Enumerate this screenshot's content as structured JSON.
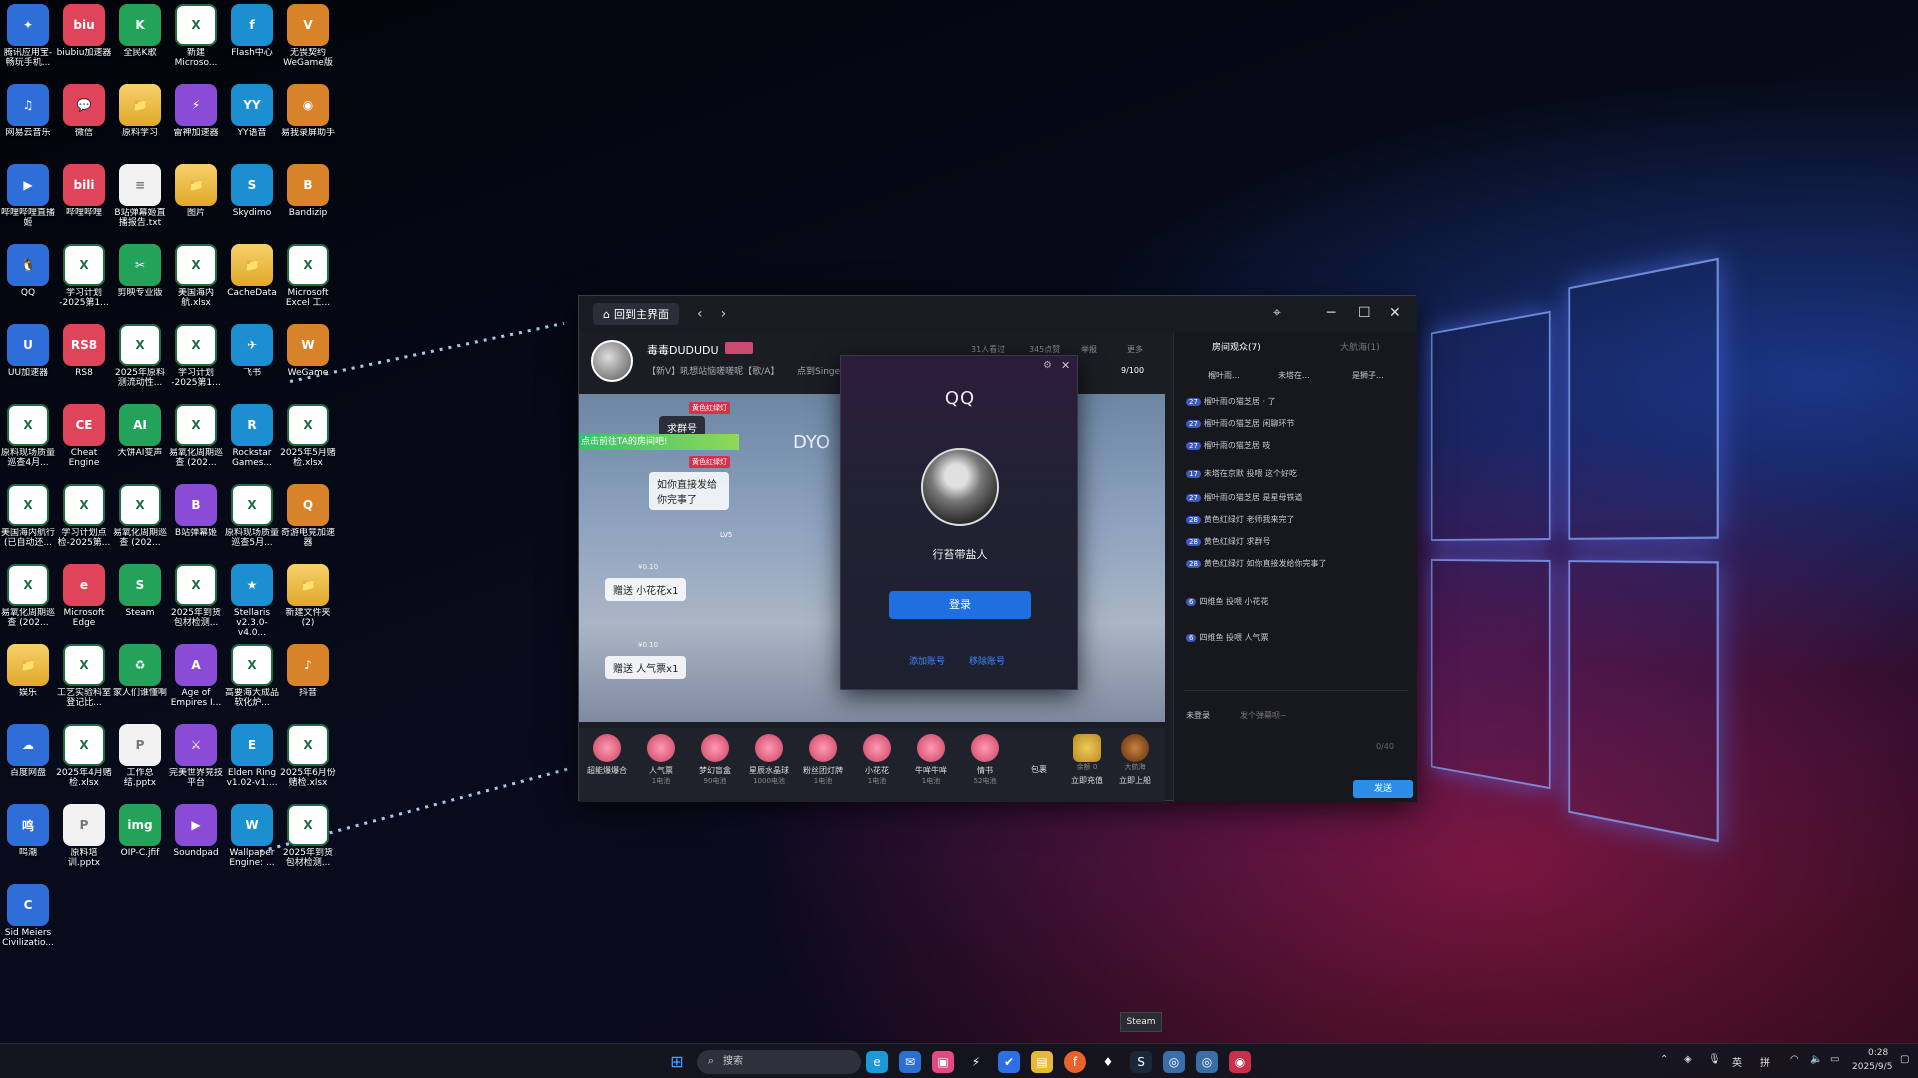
{
  "desktop": {
    "icons": [
      {
        "label": "腾讯应用宝-畅玩手机...",
        "glyph": "✦"
      },
      {
        "label": "biubiu加速器",
        "glyph": "biu"
      },
      {
        "label": "全民K歌",
        "glyph": "K"
      },
      {
        "label": "新建 Microso...",
        "glyph": "X"
      },
      {
        "label": "Flash中心",
        "glyph": "f"
      },
      {
        "label": "无畏契约 WeGame版",
        "glyph": "V"
      },
      {
        "label": "网易云音乐",
        "glyph": "♫"
      },
      {
        "label": "微信",
        "glyph": "💬"
      },
      {
        "label": "原料学习",
        "glyph": "📁"
      },
      {
        "label": "雷神加速器",
        "glyph": "⚡"
      },
      {
        "label": "YY语音",
        "glyph": "YY"
      },
      {
        "label": "易我录屏助手",
        "glyph": "◉"
      },
      {
        "label": "哔哩哔哩直播姬",
        "glyph": "▶"
      },
      {
        "label": "哔哩哔哩",
        "glyph": "bili"
      },
      {
        "label": "B站弹幕姬直播报告.txt",
        "glyph": "≡"
      },
      {
        "label": "图片",
        "glyph": "📁"
      },
      {
        "label": "Skydimo",
        "glyph": "S"
      },
      {
        "label": "Bandizip",
        "glyph": "B"
      },
      {
        "label": "QQ",
        "glyph": "🐧"
      },
      {
        "label": "学习计划 -2025第1...",
        "glyph": "X"
      },
      {
        "label": "剪映专业版",
        "glyph": "✂"
      },
      {
        "label": "美国海内航.xlsx",
        "glyph": "X"
      },
      {
        "label": "CacheData",
        "glyph": "📁"
      },
      {
        "label": "Microsoft Excel 工...",
        "glyph": "X"
      },
      {
        "label": "UU加速器",
        "glyph": "U"
      },
      {
        "label": "RS8",
        "glyph": "RS8"
      },
      {
        "label": "2025年原料测流动性...",
        "glyph": "X"
      },
      {
        "label": "学习计划 -2025第1...",
        "glyph": "X"
      },
      {
        "label": "飞书",
        "glyph": "✈"
      },
      {
        "label": "WeGame",
        "glyph": "W"
      },
      {
        "label": "原料现场质量巡查4月...",
        "glyph": "X"
      },
      {
        "label": "Cheat Engine",
        "glyph": "CE"
      },
      {
        "label": "大饼AI变声",
        "glyph": "AI"
      },
      {
        "label": "易氧化周期巡查 (202...",
        "glyph": "X"
      },
      {
        "label": "Rockstar Games...",
        "glyph": "R"
      },
      {
        "label": "2025年5月赌检.xlsx",
        "glyph": "X"
      },
      {
        "label": "美国海内航行(已自动还...",
        "glyph": "X"
      },
      {
        "label": "学习计划点检-2025第...",
        "glyph": "X"
      },
      {
        "label": "易氧化周期巡查 (202...",
        "glyph": "X"
      },
      {
        "label": "B站弹幕姬",
        "glyph": "B"
      },
      {
        "label": "原料现场质量巡查5月...",
        "glyph": "X"
      },
      {
        "label": "奇游电竞加速器",
        "glyph": "Q"
      },
      {
        "label": "易氧化周期巡查 (202...",
        "glyph": "X"
      },
      {
        "label": "Microsoft Edge",
        "glyph": "e"
      },
      {
        "label": "Steam",
        "glyph": "S"
      },
      {
        "label": "2025年到货包材检测...",
        "glyph": "X"
      },
      {
        "label": "Stellaris v2.3.0-v4.0...",
        "glyph": "★"
      },
      {
        "label": "新建文件夹 (2)",
        "glyph": "📁"
      },
      {
        "label": "娱乐",
        "glyph": "📁"
      },
      {
        "label": "工艺实验科室登记比...",
        "glyph": "X"
      },
      {
        "label": "家人们谁懂啊",
        "glyph": "♻"
      },
      {
        "label": "Age of Empires I...",
        "glyph": "A"
      },
      {
        "label": "高要海大成品软化炉...",
        "glyph": "X"
      },
      {
        "label": "抖音",
        "glyph": "♪"
      },
      {
        "label": "百度网盘",
        "glyph": "☁"
      },
      {
        "label": "2025年4月赌检.xlsx",
        "glyph": "X"
      },
      {
        "label": "工作总结.pptx",
        "glyph": "P"
      },
      {
        "label": "完美世界竞技平台",
        "glyph": "⚔"
      },
      {
        "label": "Elden Ring v1.02-v1....",
        "glyph": "E"
      },
      {
        "label": "2025年6月份赌检.xlsx",
        "glyph": "X"
      },
      {
        "label": "鸣潮",
        "glyph": "鸣"
      },
      {
        "label": "原料培训.pptx",
        "glyph": "P"
      },
      {
        "label": "OIP-C.jfif",
        "glyph": "img"
      },
      {
        "label": "Soundpad",
        "glyph": "▶"
      },
      {
        "label": "Wallpaper Engine: ...",
        "glyph": "W"
      },
      {
        "label": "2025年到货包材检测...",
        "glyph": "X"
      },
      {
        "label": "Sid Meiers Civilizatio...",
        "glyph": "C"
      }
    ]
  },
  "live_app": {
    "home_button": "回到主界面",
    "nav_back": "‹",
    "nav_forward": "›",
    "streamer_name": "毒毒DUDUDU",
    "streamer_tag": "【新V】吼想站恼嗟嗟呢【歌/A】",
    "streamer_sub2": "点到Singer",
    "stats": [
      "31人看过",
      "345点赞",
      "举报",
      "更多"
    ],
    "gift_progress": "9/100",
    "video_overlay": {
      "top_tag": "黄色红绿灯",
      "name1": "求群号",
      "banner": "点击前往TA的房间吧!",
      "tag2": "黄色红绿灯",
      "bubble": "如你直接发给你完事了",
      "lv": "LV5",
      "gift1_price": "¥0.10",
      "gift1_text": "赠送 小花花x1",
      "gift2_price": "¥0.10",
      "gift2_text": "赠送 人气票x1",
      "scroll_text": "DYO"
    },
    "gifts": [
      {
        "name": "超能爆爆合",
        "price": ""
      },
      {
        "name": "人气票",
        "price": "1电池"
      },
      {
        "name": "梦幻盲盒",
        "price": "90电池"
      },
      {
        "name": "星辰水晶球",
        "price": "1000电池"
      },
      {
        "name": "粉丝团灯牌",
        "price": "1电池"
      },
      {
        "name": "小花花",
        "price": "1电池"
      },
      {
        "name": "牛哞牛哞",
        "price": "1电池"
      },
      {
        "name": "情书",
        "price": "52电池"
      }
    ],
    "pack_label": "包裹",
    "balance_label": "余额 0",
    "recharge": "立即充值",
    "captain_label": "大航海",
    "captain_action": "立即上船",
    "side_tabs": [
      "房间观众(7)",
      "大航海(1)"
    ],
    "audience": [
      "榴叶雨...",
      "未塔在...",
      "是狮子..."
    ],
    "messages": [
      {
        "lv": "27",
        "text": "榴叶雨の猫芝居 · 了"
      },
      {
        "lv": "27",
        "text": "榴叶雨の猫芝居 闲聊环节"
      },
      {
        "lv": "27",
        "text": "榴叶雨の猫芝居 吱"
      },
      {
        "lv": "17",
        "text": "未塔在京默 投喂 这个好吃"
      },
      {
        "lv": "27",
        "text": "榴叶雨の猫芝居 是星母铁道"
      },
      {
        "lv": "28",
        "text": "黄色红绿灯 老师我来完了"
      },
      {
        "lv": "28",
        "text": "黄色红绿灯 求群号"
      },
      {
        "lv": "28",
        "text": "黄色红绿灯 如你直接发给你完事了"
      },
      {
        "lv": "6",
        "text": "四维鱼 投喂 小花花"
      },
      {
        "lv": "6",
        "text": "四维鱼 投喂 人气票"
      }
    ],
    "input_placeholder": "发个弹幕呗~",
    "char_count": "0/40",
    "send_label": "发送",
    "unlogged": "未登录"
  },
  "qq_login": {
    "title": "QQ",
    "nickname": "行苔带盐人",
    "login_button": "登录",
    "add_account": "添加账号",
    "remove_account": "移除账号"
  },
  "taskbar": {
    "search_placeholder": "搜索",
    "tooltip": "Steam",
    "ime_lang": "英",
    "ime_mode": "拼",
    "time": "0:28",
    "date": "2025/9/5"
  }
}
